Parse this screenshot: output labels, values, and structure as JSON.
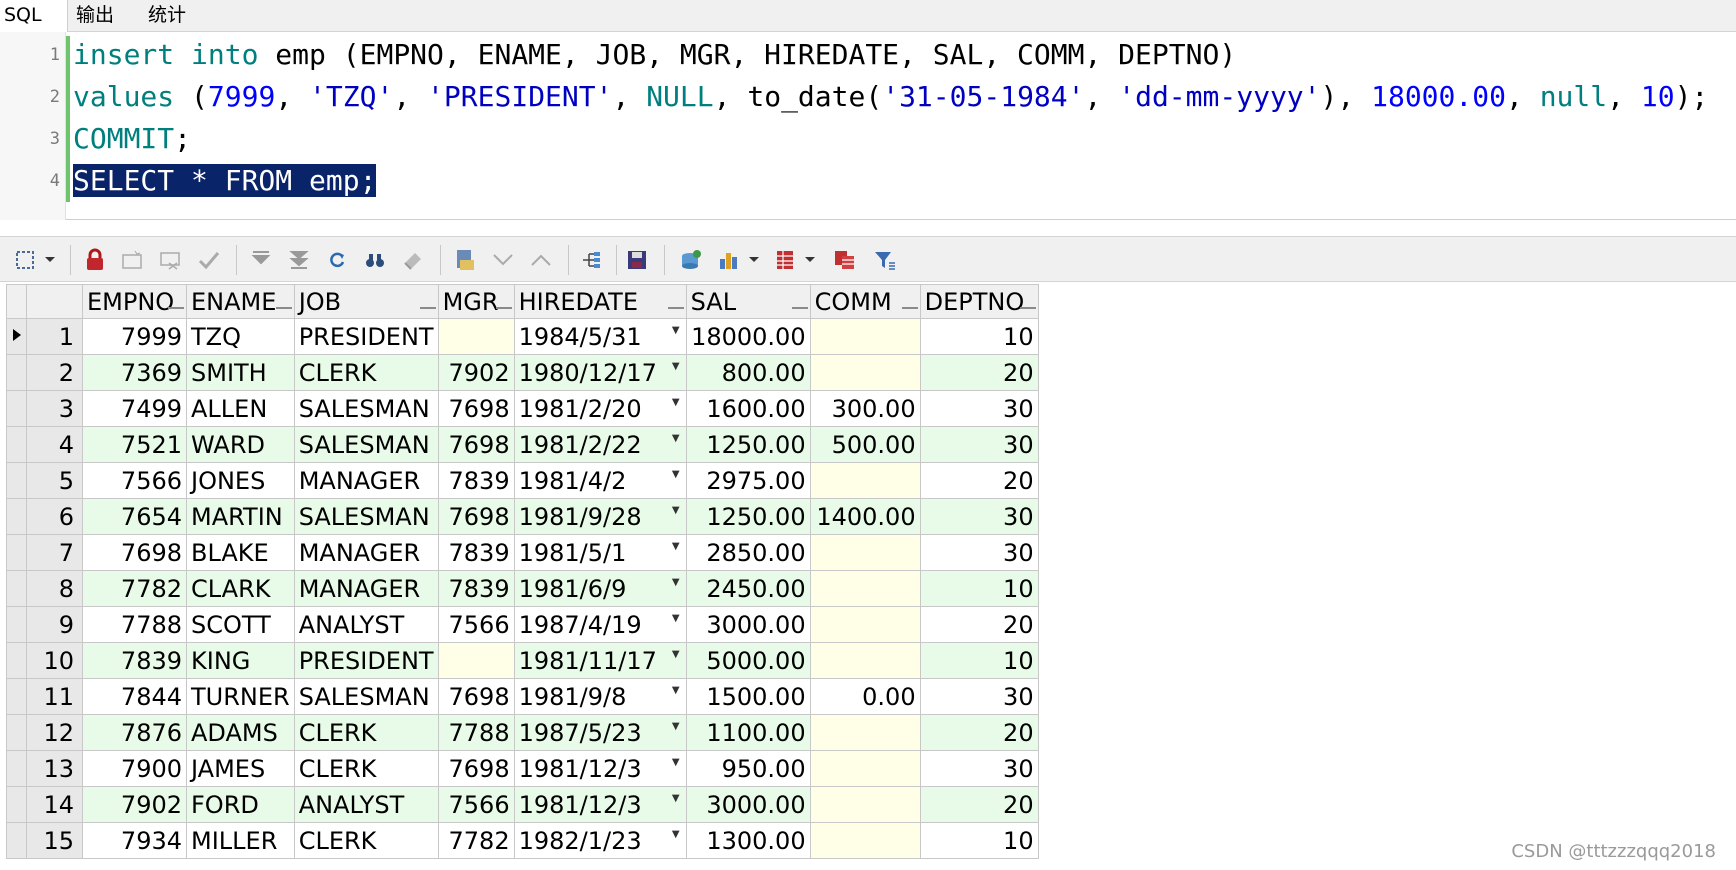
{
  "tabs": [
    {
      "label": "SQL"
    },
    {
      "label": "输出"
    },
    {
      "label": "统计"
    }
  ],
  "editor": {
    "lines": [
      {
        "no": "1"
      },
      {
        "no": "2"
      },
      {
        "no": "3"
      },
      {
        "no": "4"
      }
    ],
    "l1": {
      "kw1": "insert",
      "kw2": "into",
      "rest": " emp (EMPNO, ENAME, JOB, MGR, HIREDATE, SAL, COMM, DEPTNO)"
    },
    "l2": {
      "kw": "values",
      "p1": " (",
      "n1": "7999",
      "c1": ", ",
      "s1": "'TZQ'",
      "c2": ", ",
      "s2": "'PRESIDENT'",
      "c3": ", ",
      "k2": "NULL",
      "c4": ", to_date(",
      "s3": "'31-05-1984'",
      "c5": ", ",
      "s4": "'dd-mm-yyyy'",
      "c6": "), ",
      "n2": "18000.00",
      "c7": ", ",
      "k3": "null",
      "c8": ", ",
      "n3": "10",
      "c9": ");"
    },
    "l3": {
      "kw": "COMMIT",
      "rest": ";"
    },
    "l4": {
      "text": "SELECT * FROM emp;"
    }
  },
  "toolbar": {
    "icons": [
      "select-icon",
      "dropdown-icon",
      "lock-icon",
      "insert-record-icon",
      "delete-record-icon",
      "post-changes-icon",
      "fetch-next-icon",
      "fetch-last-icon",
      "refresh-icon",
      "find-icon",
      "clear-icon",
      "query-by-example-icon",
      "previous-query-icon",
      "next-query-icon",
      "export-tree-icon",
      "save-icon",
      "export-icon",
      "chart-icon",
      "grid-view-icon",
      "record-view-icon",
      "filter-icon"
    ]
  },
  "grid": {
    "columns": [
      "EMPNO",
      "ENAME",
      "JOB",
      "MGR",
      "HIREDATE",
      "SAL",
      "COMM",
      "DEPTNO"
    ],
    "rows": [
      {
        "n": "1",
        "empno": "7999",
        "ename": "TZQ",
        "job": "PRESIDENT",
        "mgr": "",
        "hiredate": "1984/5/31",
        "sal": "18000.00",
        "comm": "",
        "deptno": "10"
      },
      {
        "n": "2",
        "empno": "7369",
        "ename": "SMITH",
        "job": "CLERK",
        "mgr": "7902",
        "hiredate": "1980/12/17",
        "sal": "800.00",
        "comm": "",
        "deptno": "20"
      },
      {
        "n": "3",
        "empno": "7499",
        "ename": "ALLEN",
        "job": "SALESMAN",
        "mgr": "7698",
        "hiredate": "1981/2/20",
        "sal": "1600.00",
        "comm": "300.00",
        "deptno": "30"
      },
      {
        "n": "4",
        "empno": "7521",
        "ename": "WARD",
        "job": "SALESMAN",
        "mgr": "7698",
        "hiredate": "1981/2/22",
        "sal": "1250.00",
        "comm": "500.00",
        "deptno": "30"
      },
      {
        "n": "5",
        "empno": "7566",
        "ename": "JONES",
        "job": "MANAGER",
        "mgr": "7839",
        "hiredate": "1981/4/2",
        "sal": "2975.00",
        "comm": "",
        "deptno": "20"
      },
      {
        "n": "6",
        "empno": "7654",
        "ename": "MARTIN",
        "job": "SALESMAN",
        "mgr": "7698",
        "hiredate": "1981/9/28",
        "sal": "1250.00",
        "comm": "1400.00",
        "deptno": "30"
      },
      {
        "n": "7",
        "empno": "7698",
        "ename": "BLAKE",
        "job": "MANAGER",
        "mgr": "7839",
        "hiredate": "1981/5/1",
        "sal": "2850.00",
        "comm": "",
        "deptno": "30"
      },
      {
        "n": "8",
        "empno": "7782",
        "ename": "CLARK",
        "job": "MANAGER",
        "mgr": "7839",
        "hiredate": "1981/6/9",
        "sal": "2450.00",
        "comm": "",
        "deptno": "10"
      },
      {
        "n": "9",
        "empno": "7788",
        "ename": "SCOTT",
        "job": "ANALYST",
        "mgr": "7566",
        "hiredate": "1987/4/19",
        "sal": "3000.00",
        "comm": "",
        "deptno": "20"
      },
      {
        "n": "10",
        "empno": "7839",
        "ename": "KING",
        "job": "PRESIDENT",
        "mgr": "",
        "hiredate": "1981/11/17",
        "sal": "5000.00",
        "comm": "",
        "deptno": "10"
      },
      {
        "n": "11",
        "empno": "7844",
        "ename": "TURNER",
        "job": "SALESMAN",
        "mgr": "7698",
        "hiredate": "1981/9/8",
        "sal": "1500.00",
        "comm": "0.00",
        "deptno": "30"
      },
      {
        "n": "12",
        "empno": "7876",
        "ename": "ADAMS",
        "job": "CLERK",
        "mgr": "7788",
        "hiredate": "1987/5/23",
        "sal": "1100.00",
        "comm": "",
        "deptno": "20"
      },
      {
        "n": "13",
        "empno": "7900",
        "ename": "JAMES",
        "job": "CLERK",
        "mgr": "7698",
        "hiredate": "1981/12/3",
        "sal": "950.00",
        "comm": "",
        "deptno": "30"
      },
      {
        "n": "14",
        "empno": "7902",
        "ename": "FORD",
        "job": "ANALYST",
        "mgr": "7566",
        "hiredate": "1981/12/3",
        "sal": "3000.00",
        "comm": "",
        "deptno": "20"
      },
      {
        "n": "15",
        "empno": "7934",
        "ename": "MILLER",
        "job": "CLERK",
        "mgr": "7782",
        "hiredate": "1982/1/23",
        "sal": "1300.00",
        "comm": "",
        "deptno": "10"
      }
    ]
  },
  "watermark": "CSDN @tttzzzqqq2018",
  "colors": {
    "keyword": "#007f7f",
    "string": "#0000c0",
    "number": "#0000ff",
    "selection": "#0a246a",
    "alt_row": "#e8fbe8",
    "null_cell": "#ffffe8"
  }
}
